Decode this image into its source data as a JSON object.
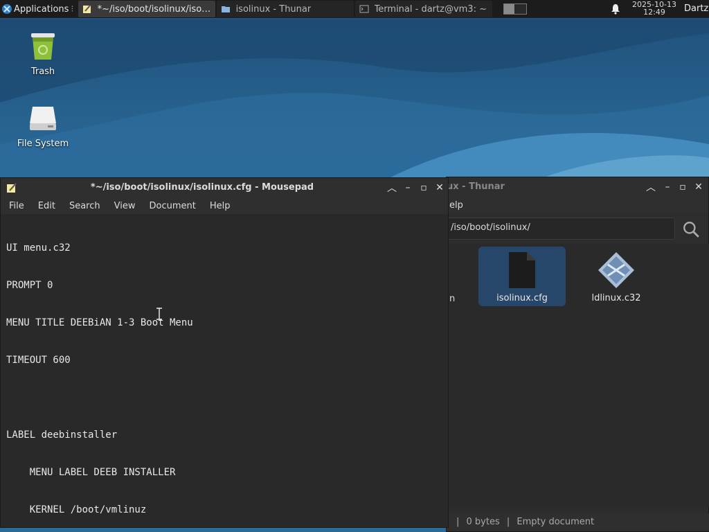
{
  "panel": {
    "applications_label": "Applications",
    "tasks": [
      {
        "label": "*~/iso/boot/isolinux/isol...",
        "icon": "mousepad-icon",
        "active": true
      },
      {
        "label": "isolinux - Thunar",
        "icon": "folder-icon",
        "active": false
      },
      {
        "label": "Terminal - dartz@vm3: ~",
        "icon": "terminal-icon",
        "active": false
      }
    ],
    "clock_date": "2025-10-13",
    "clock_time": "12:49",
    "user": "Dartz"
  },
  "desktop": {
    "icons": [
      {
        "label": "Trash",
        "icon": "trash-icon"
      },
      {
        "label": "File System",
        "icon": "drive-icon"
      }
    ]
  },
  "mousepad": {
    "title": "*~/iso/boot/isolinux/isolinux.cfg - Mousepad",
    "menu": [
      "File",
      "Edit",
      "Search",
      "View",
      "Document",
      "Help"
    ],
    "lines": [
      "UI menu.c32",
      "PROMPT 0",
      "MENU TITLE DEEBiAN 1-3 Boot Menu",
      "TIMEOUT 600",
      "",
      "LABEL deebinstaller",
      "    MENU LABEL DEEB INSTALLER",
      "    KERNEL /boot/vmlinuz",
      ""
    ]
  },
  "thunar": {
    "title_visible": "ux - Thunar",
    "menu_visible": "elp",
    "path": "/iso/boot/isolinux/",
    "partial_item_label": "n",
    "files": [
      {
        "label": "isolinux.cfg",
        "icon": "text-file-icon",
        "selected": true
      },
      {
        "label": "ldlinux.c32",
        "icon": "binary-file-icon",
        "selected": false
      }
    ],
    "status_size": "0 bytes",
    "status_type": "Empty document"
  },
  "colors": {
    "accent_selection": "#27476a",
    "panel_bg": "#1c1c1c",
    "window_bg": "#2b2b2b"
  }
}
